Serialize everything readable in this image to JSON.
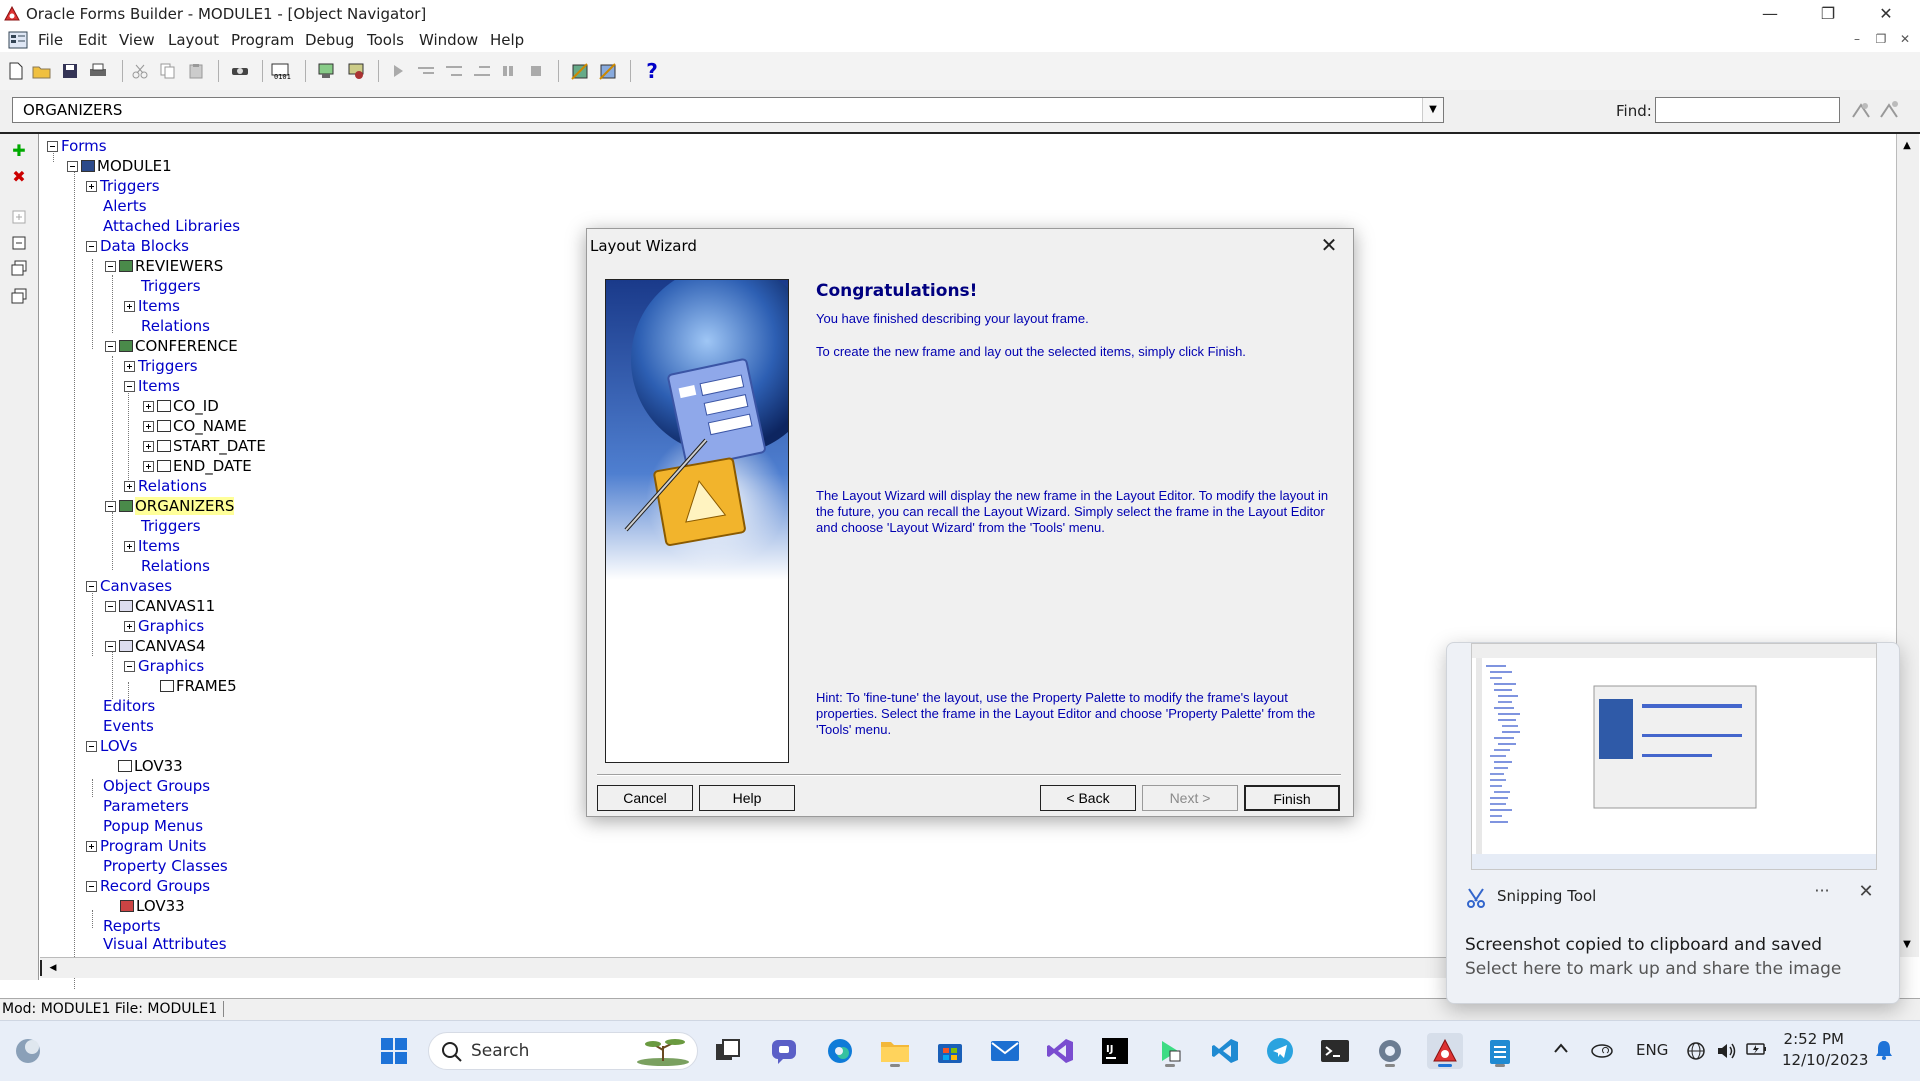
{
  "window": {
    "title": "Oracle Forms Builder - MODULE1 - [Object Navigator]"
  },
  "menu": [
    "File",
    "Edit",
    "View",
    "Layout",
    "Program",
    "Debug",
    "Tools",
    "Window",
    "Help"
  ],
  "toolbar": {
    "help_symbol": "?"
  },
  "selector": {
    "value": "ORGANIZERS",
    "find_label": "Find:",
    "find_value": ""
  },
  "tree": [
    {
      "label": "Forms"
    },
    {
      "label": "MODULE1"
    },
    {
      "label": "Triggers"
    },
    {
      "label": "Alerts"
    },
    {
      "label": "Attached Libraries"
    },
    {
      "label": "Data Blocks"
    },
    {
      "label": "REVIEWERS"
    },
    {
      "label": "Triggers"
    },
    {
      "label": "Items"
    },
    {
      "label": "Relations"
    },
    {
      "label": "CONFERENCE"
    },
    {
      "label": "Triggers"
    },
    {
      "label": "Items"
    },
    {
      "label": "CO_ID"
    },
    {
      "label": "CO_NAME"
    },
    {
      "label": "START_DATE"
    },
    {
      "label": "END_DATE"
    },
    {
      "label": "Relations"
    },
    {
      "label": "ORGANIZERS"
    },
    {
      "label": "Triggers"
    },
    {
      "label": "Items"
    },
    {
      "label": "Relations"
    },
    {
      "label": "Canvases"
    },
    {
      "label": "CANVAS11"
    },
    {
      "label": "Graphics"
    },
    {
      "label": "CANVAS4"
    },
    {
      "label": "Graphics"
    },
    {
      "label": "FRAME5"
    },
    {
      "label": "Editors"
    },
    {
      "label": "Events"
    },
    {
      "label": "LOVs"
    },
    {
      "label": "LOV33"
    },
    {
      "label": "Object Groups"
    },
    {
      "label": "Parameters"
    },
    {
      "label": "Popup Menus"
    },
    {
      "label": "Program Units"
    },
    {
      "label": "Property Classes"
    },
    {
      "label": "Record Groups"
    },
    {
      "label": "LOV33"
    },
    {
      "label": "Reports"
    },
    {
      "label": "Visual Attributes"
    }
  ],
  "status": {
    "text": "Mod: MODULE1 File: MODULE1"
  },
  "dialog": {
    "title": "Layout Wizard",
    "heading": "Congratulations!",
    "p1": "You have finished describing your layout frame.",
    "p2": "To create the new frame and lay out the selected items, simply click Finish.",
    "p3": "The Layout Wizard will display the new frame in the Layout Editor. To modify the layout in the future, you can recall the Layout Wizard. Simply select the frame in the Layout Editor and choose 'Layout Wizard' from the 'Tools' menu.",
    "p4": "Hint: To 'fine-tune' the layout, use the Property Palette to modify the frame's layout properties. Select the frame in the Layout Editor and choose 'Property Palette' from the 'Tools' menu.",
    "buttons": {
      "cancel": "Cancel",
      "help": "Help",
      "back": "< Back",
      "next": "Next >",
      "finish": "Finish"
    }
  },
  "toast": {
    "app": "Snipping Tool",
    "more": "···",
    "line1": "Screenshot copied to clipboard and saved",
    "line2": "Select here to mark up and share the image"
  },
  "taskbar": {
    "search_placeholder": "Search",
    "lang": "ENG",
    "time": "2:52 PM",
    "date": "12/10/2023"
  },
  "colors": {
    "tree_label": "#0000c8",
    "dialog_heading": "#000080",
    "selection_highlight": "#ffff99"
  }
}
